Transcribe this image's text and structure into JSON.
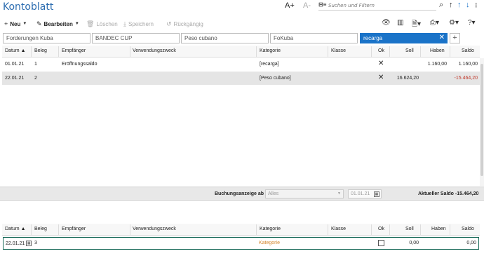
{
  "window": {
    "title": "Kontoblatt"
  },
  "top_icons": {
    "font_bigger": "A+",
    "font_smaller": "A-",
    "filter_icon": "filter-list-icon"
  },
  "search": {
    "placeholder": "Suchen und Filtern"
  },
  "toolbar": {
    "new_label": "Neu",
    "edit_label": "Bearbeiten",
    "delete_label": "Löschen",
    "save_label": "Speichern",
    "undo_label": "Rückgängig"
  },
  "filters": {
    "items": [
      "Forderungen Kuba",
      "BANDEC CUP",
      "Peso cubano",
      "FoKuba",
      "recarga"
    ],
    "selected": "recarga"
  },
  "table": {
    "columns": [
      "Datum",
      "Beleg",
      "Empfänger",
      "Verwendungszweck",
      "Kategorie",
      "Klasse",
      "Ok",
      "Soll",
      "Haben",
      "Saldo"
    ],
    "sort_indicator": "▲",
    "rows": [
      {
        "datum": "01.01.21",
        "beleg": "1",
        "empfaenger": "Eröffnungssaldo",
        "zweck": "",
        "kategorie": "[recarga]",
        "klasse": "",
        "ok": "✕",
        "soll": "",
        "haben": "1.160,00",
        "saldo": "1.160,00"
      },
      {
        "datum": "22.01.21",
        "beleg": "2",
        "empfaenger": "",
        "zweck": "",
        "kategorie": "[Peso cubano]",
        "klasse": "",
        "ok": "✕",
        "soll": "16.624,20",
        "haben": "",
        "saldo": "-15.464,20"
      }
    ]
  },
  "status": {
    "buchungsanzeige_label": "Buchungsanzeige ab",
    "buchungsanzeige_value": "Alles",
    "date_value": "01.01.21",
    "saldo_label": "Aktueller Saldo -15.464,20"
  },
  "editor": {
    "columns": [
      "Datum",
      "Beleg",
      "Empfänger",
      "Verwendungszweck",
      "Kategorie",
      "Klasse",
      "Ok",
      "Soll",
      "Haben",
      "Saldo"
    ],
    "datum": "22.01.21",
    "beleg": "3",
    "kategorie_placeholder": "Kategorie",
    "soll": "0,00",
    "saldo": "0,00"
  },
  "colors": {
    "accent": "#1a73c8",
    "title": "#2b6cb0",
    "negative": "#c0392b",
    "category_placeholder": "#d4862c",
    "editor_border": "#1a6b5a"
  }
}
